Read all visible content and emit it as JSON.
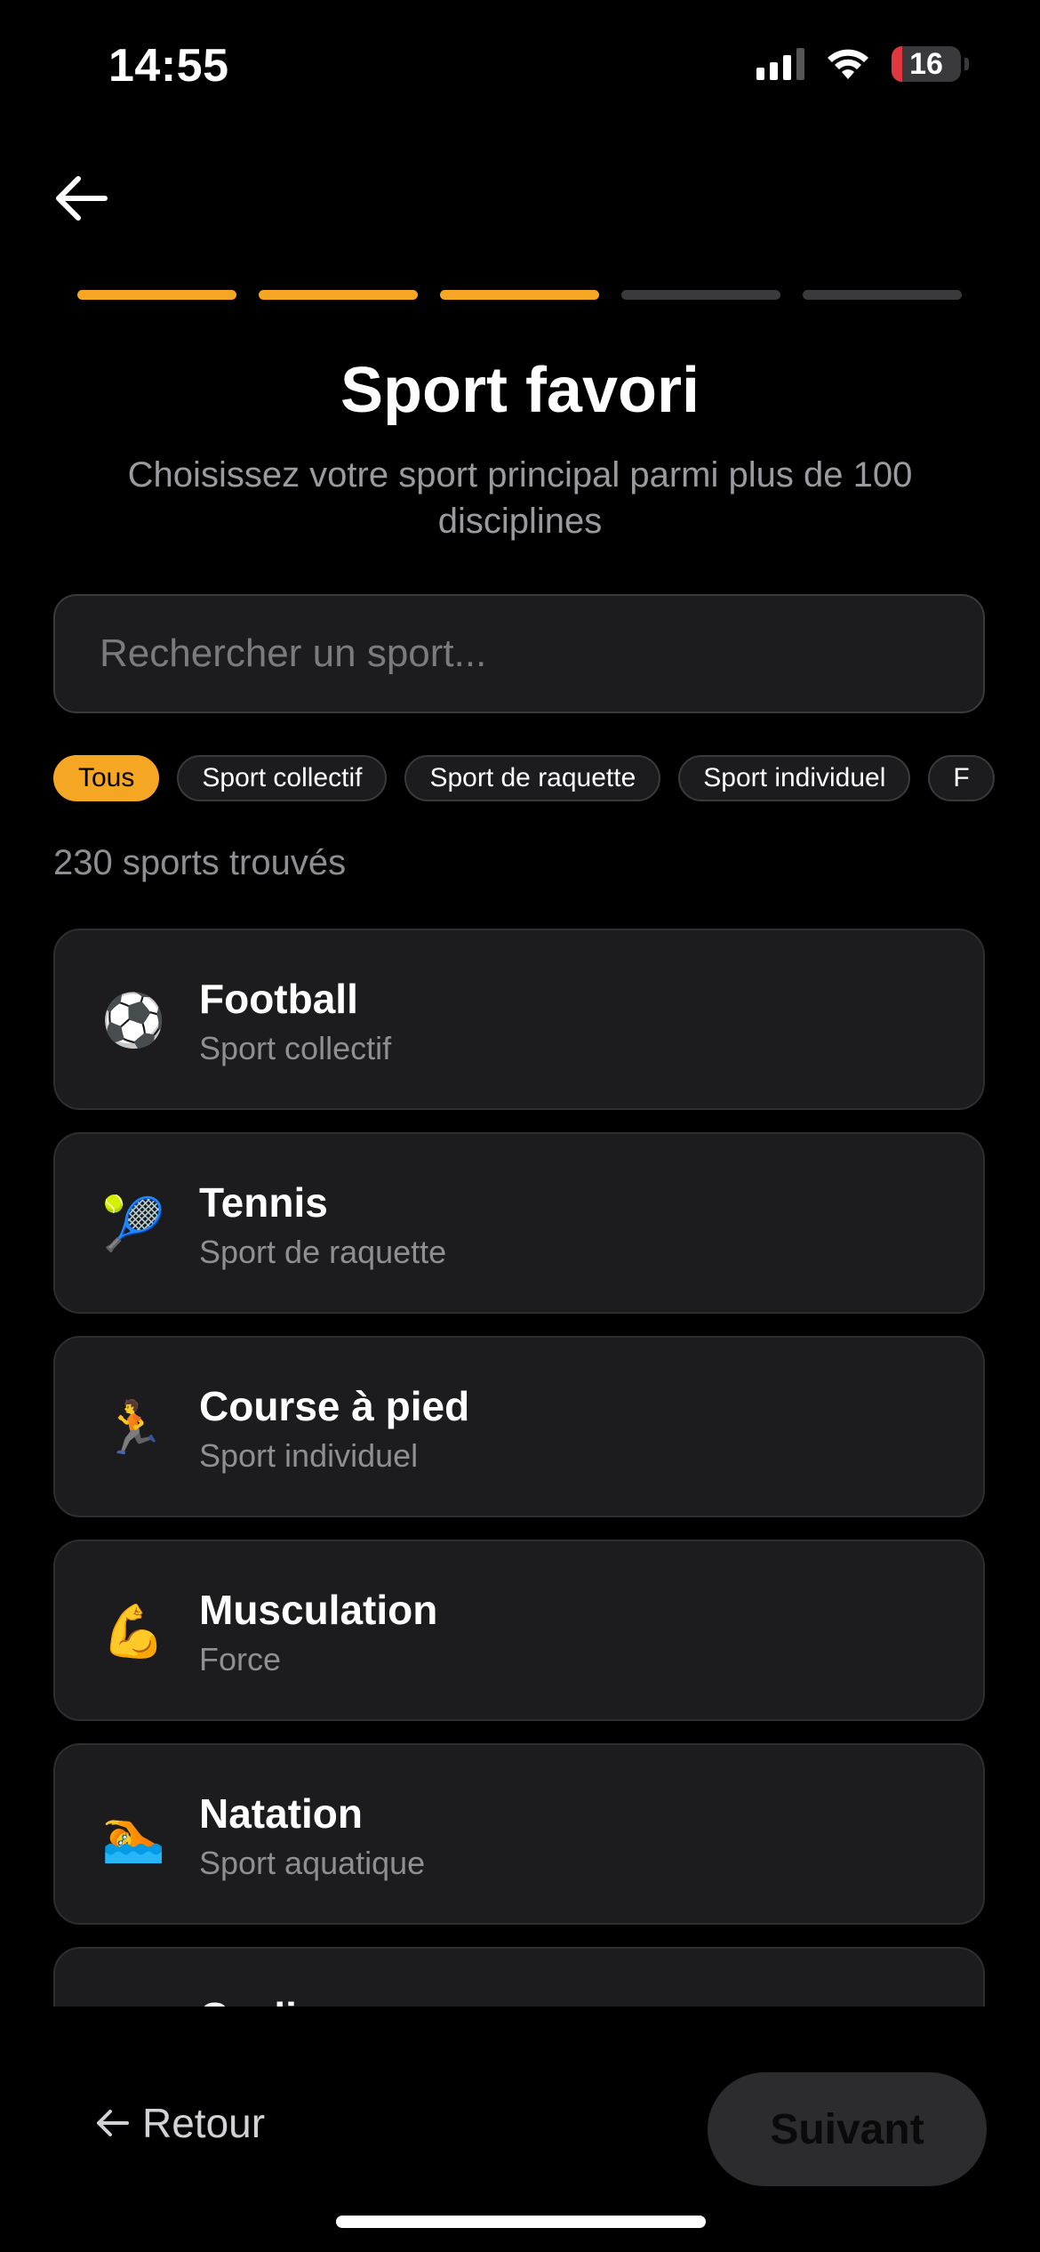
{
  "status_bar": {
    "time": "14:55",
    "battery": "16",
    "battery_level": 0.16
  },
  "progress": {
    "total_steps": 5,
    "completed_steps": 3,
    "accent": "#f5a623"
  },
  "header": {
    "title": "Sport favori",
    "subtitle": "Choisissez votre sport principal parmi plus de 100 disciplines"
  },
  "search": {
    "placeholder": "Rechercher un sport...",
    "value": ""
  },
  "filters": [
    {
      "label": "Tous",
      "active": true
    },
    {
      "label": "Sport collectif",
      "active": false
    },
    {
      "label": "Sport de raquette",
      "active": false
    },
    {
      "label": "Sport individuel",
      "active": false
    },
    {
      "label": "F",
      "active": false
    }
  ],
  "results_count": "230 sports trouvés",
  "sports": [
    {
      "name": "Football",
      "category": "Sport collectif",
      "icon": "⚽"
    },
    {
      "name": "Tennis",
      "category": "Sport de raquette",
      "icon": "🎾"
    },
    {
      "name": "Course à pied",
      "category": "Sport individuel",
      "icon": "🏃"
    },
    {
      "name": "Musculation",
      "category": "Force",
      "icon": "💪"
    },
    {
      "name": "Natation",
      "category": "Sport aquatique",
      "icon": "🏊"
    },
    {
      "name": "Cyclisme",
      "category": "",
      "icon": "🚴"
    }
  ],
  "footer": {
    "back_label": "Retour",
    "next_label": "Suivant"
  }
}
